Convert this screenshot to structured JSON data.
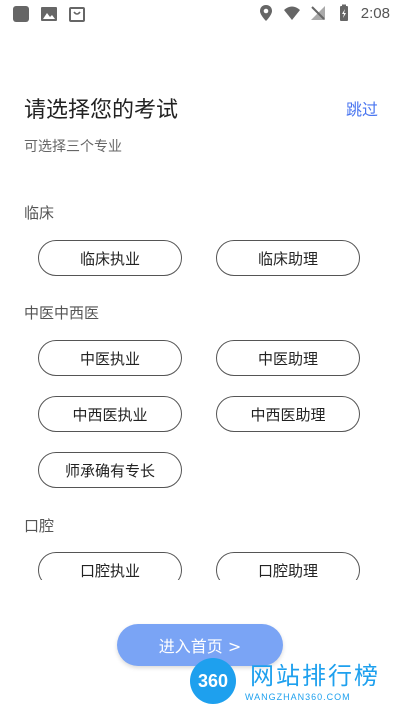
{
  "status_bar": {
    "time": "2:08"
  },
  "header": {
    "title": "请选择您的考试",
    "skip_label": "跳过",
    "subtitle": "可选择三个专业"
  },
  "sections": [
    {
      "label": "临床",
      "options": [
        "临床执业",
        "临床助理"
      ]
    },
    {
      "label": "中医中西医",
      "options": [
        "中医执业",
        "中医助理",
        "中西医执业",
        "中西医助理",
        "师承确有专长"
      ]
    },
    {
      "label": "口腔",
      "options": [
        "口腔执业",
        "口腔助理"
      ]
    }
  ],
  "enter_button": {
    "label": "进入首页 >"
  },
  "watermark": {
    "logo_text": "360",
    "name": "网站排行榜",
    "url": "WANGZHAN360.COM"
  },
  "colors": {
    "accent": "#4a76f0",
    "button": "#7aa4f5",
    "watermark": "#1ea0ee"
  }
}
